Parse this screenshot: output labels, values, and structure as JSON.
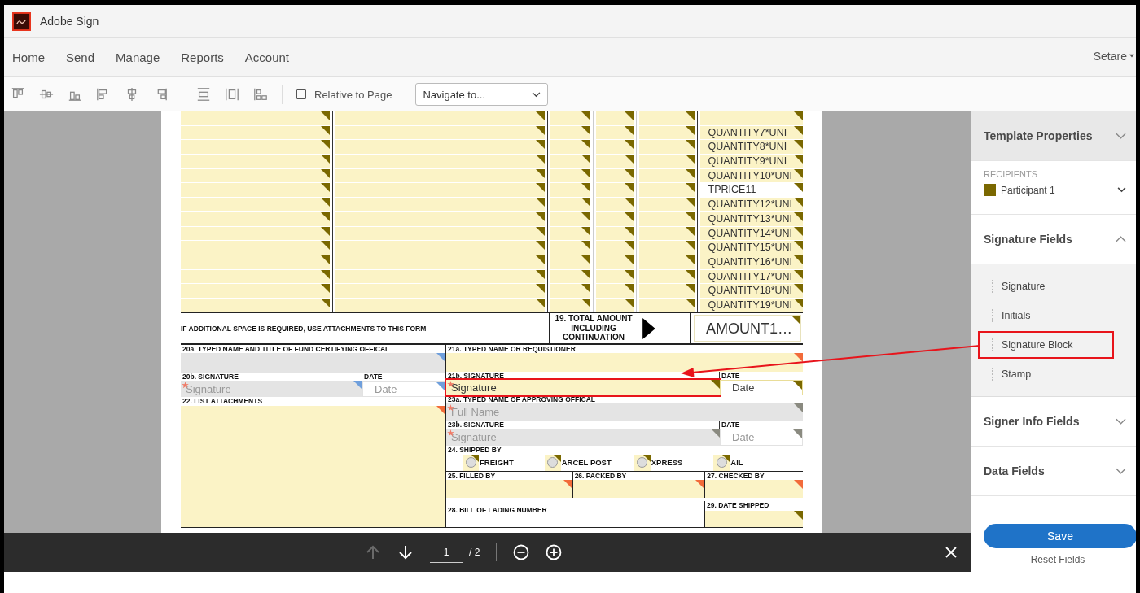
{
  "app": {
    "title": "Adobe Sign"
  },
  "nav": [
    {
      "label": "Home"
    },
    {
      "label": "Send"
    },
    {
      "label": "Manage"
    },
    {
      "label": "Reports"
    },
    {
      "label": "Account"
    }
  ],
  "user": {
    "name": "Setare"
  },
  "toolbar": {
    "relative": {
      "label": "Relative to Page",
      "checked": false
    },
    "navigate": {
      "value": "Navigate to..."
    }
  },
  "form": {
    "price_column": [
      "QUANTITY7*UNI",
      "QUANTITY8*UNI",
      "QUANTITY9*UNI",
      "QUANTITY10*UNI",
      "TPRICE11",
      "QUANTITY12*UNI",
      "QUANTITY13*UNI",
      "QUANTITY14*UNI",
      "QUANTITY15*UNI",
      "QUANTITY16*UNI",
      "QUANTITY17*UNI",
      "QUANTITY18*UNI",
      "QUANTITY19*UNI"
    ],
    "note": "IF ADDITIONAL SPACE IS REQUIRED, USE ATTACHMENTS TO THIS FORM",
    "total_label": "19. TOTAL AMOUNT INCLUDING CONTINUATION",
    "total_value": {
      "value": "AMOUNT1…",
      "color": "#7a6800"
    },
    "f20a": {
      "label": "20a. TYPED NAME AND TITLE OF FUND CERTIFYING OFFICAL",
      "field": {
        "assigned": false,
        "color": "#6f9fdc"
      }
    },
    "f20b": {
      "label": "20b. SIGNATURE",
      "date_label": "DATE",
      "field": {
        "assigned": false,
        "required": true,
        "placeholder": "Signature",
        "color": "#6f9fdc"
      },
      "date": {
        "kind": "date",
        "assigned": false,
        "placeholder": "Date",
        "color": "#6f9fdc"
      }
    },
    "f22": {
      "label": "22. LIST ATTACHMENTS",
      "field": {
        "assigned": true,
        "color": "#f26b3a"
      }
    },
    "f21a": {
      "label": "21a. TYPED NAME OR REQUISTIONER",
      "field": {
        "assigned": true,
        "color": "#f26b3a"
      }
    },
    "f21b": {
      "label": "21b. SIGNATURE",
      "date_label": "DATE",
      "field": {
        "assigned": true,
        "required": true,
        "placeholder": "Signature",
        "color": "#7a6800",
        "highlighted": true
      },
      "date": {
        "kind": "date",
        "assigned": true,
        "placeholder": "Date",
        "color": "#7a6800"
      }
    },
    "f23a": {
      "label": "23a. TYPED NAME OF APPROVING OFFICAL",
      "field": {
        "assigned": false,
        "required": true,
        "placeholder": "Full Name",
        "color": "#8a8a80"
      }
    },
    "f23b": {
      "label": "23b. SIGNATURE",
      "date_label": "DATE",
      "field": {
        "assigned": false,
        "required": true,
        "placeholder": "Signature",
        "color": "#8a8a80"
      },
      "date": {
        "kind": "date",
        "assigned": false,
        "placeholder": "Date",
        "color": "#8a8a80"
      }
    },
    "f24": {
      "label": "24. SHIPPED BY",
      "options": [
        {
          "label": "FREIGHT",
          "selected": false
        },
        {
          "label": "ARCEL POST",
          "selected": false
        },
        {
          "label": "XPRESS",
          "selected": false
        },
        {
          "label": "AIL",
          "selected": false
        }
      ]
    },
    "row25": [
      {
        "label": "25. FILLED BY",
        "field": {
          "assigned": true,
          "color": "#f26b3a"
        }
      },
      {
        "label": "26. PACKED BY",
        "field": {
          "assigned": true,
          "color": "#f26b3a"
        }
      },
      {
        "label": "27. CHECKED BY",
        "field": {
          "assigned": true,
          "color": "#f26b3a"
        }
      }
    ],
    "f28": {
      "label": "28. BILL OF LADING NUMBER"
    },
    "f29": {
      "label": "29. DATE SHIPPED",
      "field": {
        "assigned": true,
        "color": "#7a6800"
      }
    }
  },
  "sidebar": {
    "template_properties": {
      "title": "Template Properties",
      "expanded": false
    },
    "recipients": {
      "label": "RECIPIENTS",
      "participant": {
        "name": "Participant 1",
        "color": "#7a6800"
      }
    },
    "sections": [
      {
        "title": "Signature Fields",
        "expanded": true,
        "items": [
          {
            "label": "Signature",
            "highlighted": false
          },
          {
            "label": "Initials",
            "highlighted": false
          },
          {
            "label": "Signature Block",
            "highlighted": true
          },
          {
            "label": "Stamp",
            "highlighted": false
          }
        ]
      },
      {
        "title": "Signer Info Fields",
        "expanded": false
      },
      {
        "title": "Data Fields",
        "expanded": false
      }
    ],
    "save": "Save",
    "reset": "Reset Fields"
  },
  "pager": {
    "prev_disabled": true,
    "page": "1",
    "total": "/ 2"
  }
}
